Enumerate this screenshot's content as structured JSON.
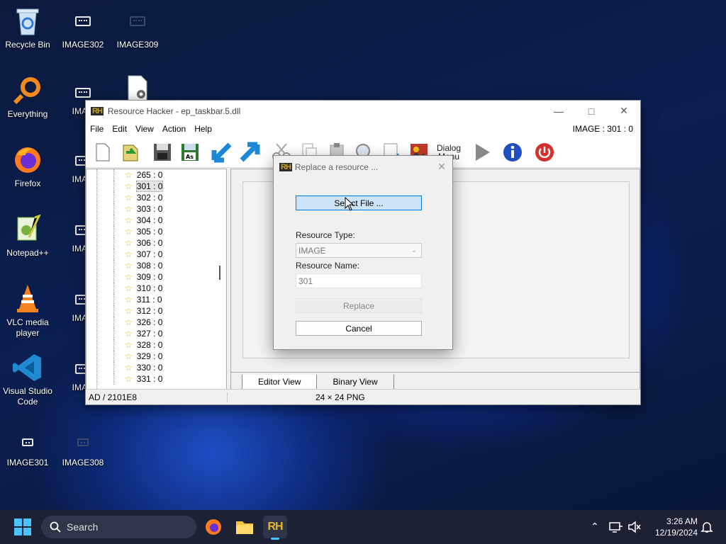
{
  "desktop": {
    "icons": [
      {
        "label": "Recycle Bin"
      },
      {
        "label": "IMAGE302"
      },
      {
        "label": "IMAGE309"
      },
      {
        "label": "Everything"
      },
      {
        "label": "IMAG"
      },
      {
        "label": "Firefox"
      },
      {
        "label": "IMAG"
      },
      {
        "label": "Notepad++"
      },
      {
        "label": "IMAG"
      },
      {
        "label": "VLC media player"
      },
      {
        "label": "IMAG"
      },
      {
        "label": "Visual Studio Code"
      },
      {
        "label": "IMAG"
      },
      {
        "label": "IMAGE301"
      },
      {
        "label": "IMAGE308"
      }
    ]
  },
  "window": {
    "logo": "RH",
    "title": "Resource Hacker - ep_taskbar.5.dll",
    "menu": [
      "File",
      "Edit",
      "View",
      "Action",
      "Help"
    ],
    "resource_indicator": "IMAGE : 301 : 0",
    "toolbar_dialog_label": "Dialog Menu",
    "tree_items": [
      "265 : 0",
      "301 : 0",
      "302 : 0",
      "303 : 0",
      "304 : 0",
      "305 : 0",
      "306 : 0",
      "307 : 0",
      "308 : 0",
      "309 : 0",
      "310 : 0",
      "311 : 0",
      "312 : 0",
      "326 : 0",
      "327 : 0",
      "328 : 0",
      "329 : 0",
      "330 : 0",
      "331 : 0"
    ],
    "tabs": [
      "Editor View",
      "Binary View"
    ],
    "status_left": "AD / 2101E8",
    "status_right": "24 × 24  PNG"
  },
  "dialog": {
    "title": "Replace a resource ...",
    "select_file": "Select File ...",
    "resource_type_label": "Resource Type:",
    "resource_type_value": "IMAGE",
    "resource_name_label": "Resource Name:",
    "resource_name_value": "301",
    "replace_button": "Replace",
    "cancel_button": "Cancel"
  },
  "taskbar": {
    "search_placeholder": "Search",
    "time": "3:26 AM",
    "date": "12/19/2024"
  }
}
